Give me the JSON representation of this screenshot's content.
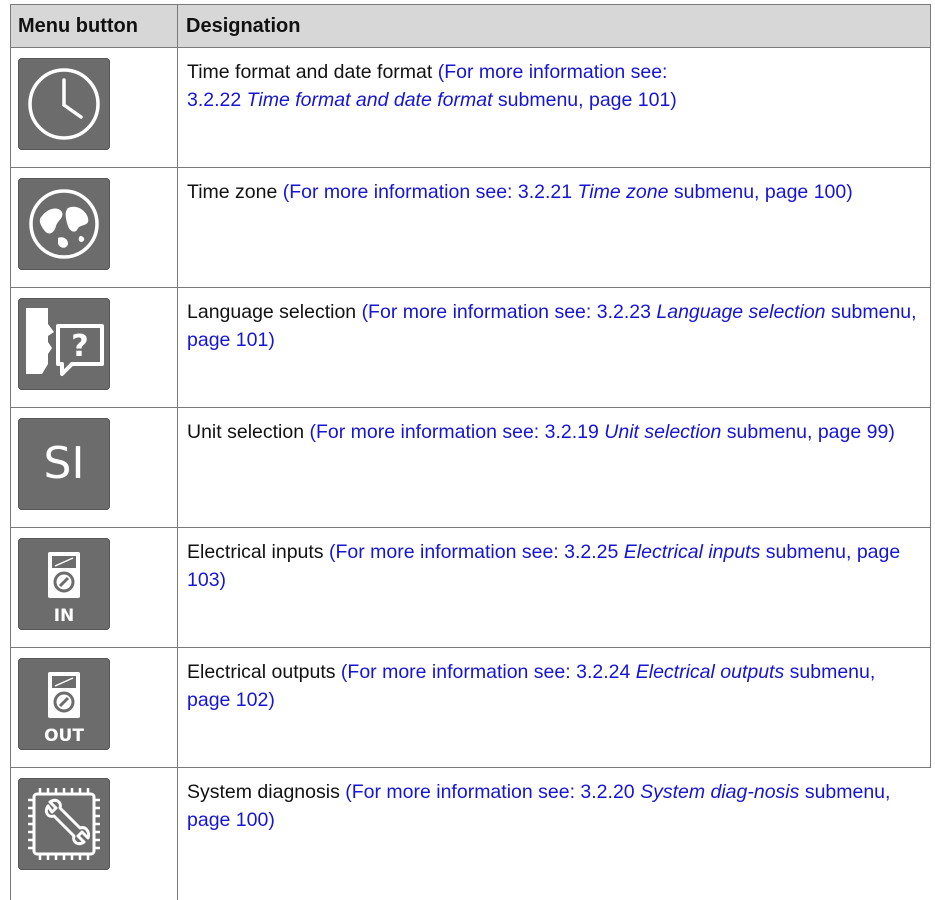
{
  "header": {
    "col1": "Menu button",
    "col2": "Designation"
  },
  "ref_prefix": "(For more information see:",
  "rows": [
    {
      "icon": "clock-icon",
      "title": "Time format and date format",
      "see": "(For more information see:",
      "section": "3.2.22",
      "target": "Time format and date format",
      "rest": "submenu, page 101)"
    },
    {
      "icon": "globe-map-icon",
      "title": "Time zone",
      "see": "(For more information see:",
      "section": "3.2.21",
      "target": "Time zone",
      "rest": "submenu, page 100)"
    },
    {
      "icon": "speaker-question-icon",
      "title": "Language selection",
      "see": "(For more information see:",
      "section": "3.2.23",
      "target": "Language selection",
      "rest": "submenu, page 101)"
    },
    {
      "icon": "si-units-icon",
      "icon_text": "SI",
      "title": "Unit selection",
      "see": "(For more information see:",
      "section": "3.2.19",
      "target": "Unit selection",
      "rest": "submenu, page 99)"
    },
    {
      "icon": "meter-in-icon",
      "icon_text": "IN",
      "title": "Electrical inputs",
      "see": "(For more information see:",
      "section": "3.2.25",
      "target": "Electrical inputs",
      "rest": "submenu, page 103)"
    },
    {
      "icon": "meter-out-icon",
      "icon_text": "OUT",
      "title": "Electrical outputs",
      "see": "(For more information see:",
      "section": "3.2.24",
      "target": "Electrical outputs",
      "rest": "submenu, page 102)"
    },
    {
      "icon": "chip-wrench-icon",
      "title": "System diagnosis",
      "see": "(For more information see:",
      "section": "3.2.20",
      "target": "System diag-nosis",
      "rest": "submenu, page 100)"
    }
  ],
  "colors": {
    "header_bg": "#d7d7d7",
    "icon_bg": "#6c6c6c",
    "link": "#1515d6",
    "border": "#7a7a7a"
  }
}
